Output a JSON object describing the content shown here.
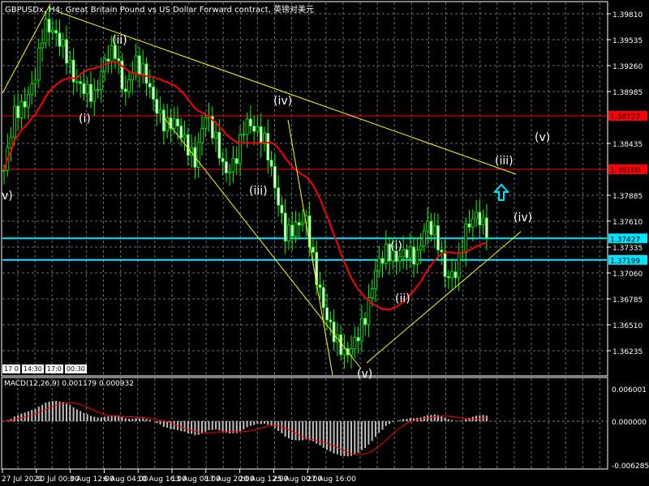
{
  "header": {
    "title": "GBPUSDx, H4:  Great Britain Pound vs US Dollar Forward contract, 英镑对美元"
  },
  "timebox": [
    "17 0",
    "14:30",
    "17:0",
    "00:30"
  ],
  "colors": {
    "bull": "#00ff00",
    "ma": "#ff0000",
    "trend": "#ffff00",
    "level_red": "#ff0000",
    "level_cyan": "#00e5ff",
    "grid": "#607080",
    "histogram": "#c0c0c0"
  },
  "chart_data": [
    {
      "type": "candlestick",
      "title": "GBPUSDx, H4",
      "ylim": [
        1.361,
        1.4
      ],
      "yticks": [
        "1.39810",
        "1.39535",
        "1.39260",
        "1.38985",
        "1.38435",
        "1.37885",
        "1.37610",
        "1.37335",
        "1.37060",
        "1.36785",
        "1.36510",
        "1.36235"
      ],
      "xticks": [
        "27 Jul 2021",
        "30 Jul 00:00",
        "3 Aug 12:00",
        "6 Aug 04:00",
        "10 Aug 16:00",
        "13 Aug 08:00",
        "17 Aug 20:00",
        "20 Aug 12:00",
        "25 Aug 00:00",
        "27 Aug 16:00"
      ],
      "close_keypoints": [
        1.3815,
        1.3875,
        1.3884,
        1.391,
        1.397,
        1.3961,
        1.3944,
        1.391,
        1.3901,
        1.3893,
        1.3931,
        1.3944,
        1.3893,
        1.3931,
        1.3918,
        1.3884,
        1.3862,
        1.3867,
        1.3845,
        1.3824,
        1.3875,
        1.385,
        1.3811,
        1.3824,
        1.3867,
        1.3858,
        1.3845,
        1.3794,
        1.3746,
        1.3755,
        1.3764,
        1.3704,
        1.3661,
        1.3635,
        1.3618,
        1.3635,
        1.3661,
        1.3712,
        1.3729,
        1.3721,
        1.3729,
        1.3721,
        1.3759,
        1.3746,
        1.3699,
        1.3708,
        1.3755,
        1.3768,
        1.3751
      ],
      "levels": [
        {
          "price": "1.38727",
          "color": "red"
        },
        {
          "price": "1.38160",
          "color": "red"
        },
        {
          "price": "1.37427",
          "color": "cyan"
        },
        {
          "price": "1.37199",
          "color": "cyan"
        }
      ],
      "wave_labels": [
        "v)",
        "(i)",
        "(ii)",
        "(iii)",
        "(iv)",
        "(v)",
        "(i)",
        "(ii)",
        "(iii)",
        "(iv)",
        "(v)"
      ]
    },
    {
      "type": "bar+line",
      "title": "MACD(12,26,9) 0.001179 0.000932",
      "ylim": [
        -0.006285,
        0.006001
      ],
      "yticks": [
        "0.006001",
        "0.000000",
        "-0.006285"
      ]
    }
  ]
}
